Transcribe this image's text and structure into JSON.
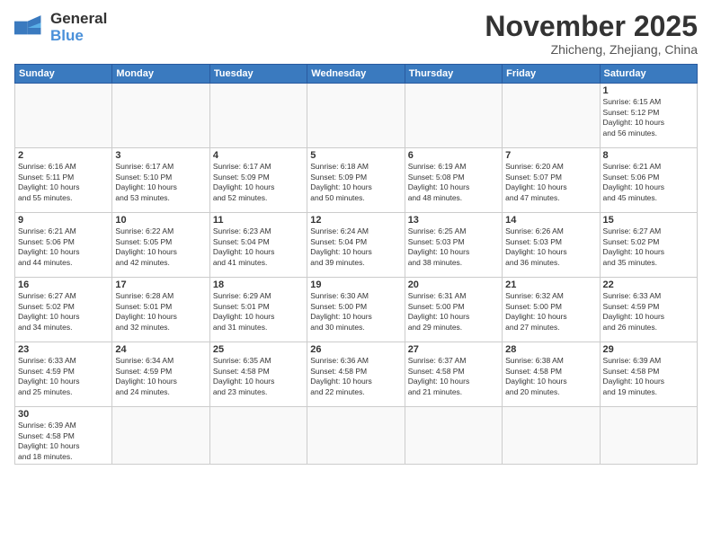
{
  "header": {
    "logo_general": "General",
    "logo_blue": "Blue",
    "month_title": "November 2025",
    "location": "Zhicheng, Zhejiang, China"
  },
  "days_of_week": [
    "Sunday",
    "Monday",
    "Tuesday",
    "Wednesday",
    "Thursday",
    "Friday",
    "Saturday"
  ],
  "weeks": [
    [
      {
        "day": null,
        "info": null
      },
      {
        "day": null,
        "info": null
      },
      {
        "day": null,
        "info": null
      },
      {
        "day": null,
        "info": null
      },
      {
        "day": null,
        "info": null
      },
      {
        "day": null,
        "info": null
      },
      {
        "day": "1",
        "info": "Sunrise: 6:15 AM\nSunset: 5:12 PM\nDaylight: 10 hours\nand 56 minutes."
      }
    ],
    [
      {
        "day": "2",
        "info": "Sunrise: 6:16 AM\nSunset: 5:11 PM\nDaylight: 10 hours\nand 55 minutes."
      },
      {
        "day": "3",
        "info": "Sunrise: 6:17 AM\nSunset: 5:10 PM\nDaylight: 10 hours\nand 53 minutes."
      },
      {
        "day": "4",
        "info": "Sunrise: 6:17 AM\nSunset: 5:09 PM\nDaylight: 10 hours\nand 52 minutes."
      },
      {
        "day": "5",
        "info": "Sunrise: 6:18 AM\nSunset: 5:09 PM\nDaylight: 10 hours\nand 50 minutes."
      },
      {
        "day": "6",
        "info": "Sunrise: 6:19 AM\nSunset: 5:08 PM\nDaylight: 10 hours\nand 48 minutes."
      },
      {
        "day": "7",
        "info": "Sunrise: 6:20 AM\nSunset: 5:07 PM\nDaylight: 10 hours\nand 47 minutes."
      },
      {
        "day": "8",
        "info": "Sunrise: 6:21 AM\nSunset: 5:06 PM\nDaylight: 10 hours\nand 45 minutes."
      }
    ],
    [
      {
        "day": "9",
        "info": "Sunrise: 6:21 AM\nSunset: 5:06 PM\nDaylight: 10 hours\nand 44 minutes."
      },
      {
        "day": "10",
        "info": "Sunrise: 6:22 AM\nSunset: 5:05 PM\nDaylight: 10 hours\nand 42 minutes."
      },
      {
        "day": "11",
        "info": "Sunrise: 6:23 AM\nSunset: 5:04 PM\nDaylight: 10 hours\nand 41 minutes."
      },
      {
        "day": "12",
        "info": "Sunrise: 6:24 AM\nSunset: 5:04 PM\nDaylight: 10 hours\nand 39 minutes."
      },
      {
        "day": "13",
        "info": "Sunrise: 6:25 AM\nSunset: 5:03 PM\nDaylight: 10 hours\nand 38 minutes."
      },
      {
        "day": "14",
        "info": "Sunrise: 6:26 AM\nSunset: 5:03 PM\nDaylight: 10 hours\nand 36 minutes."
      },
      {
        "day": "15",
        "info": "Sunrise: 6:27 AM\nSunset: 5:02 PM\nDaylight: 10 hours\nand 35 minutes."
      }
    ],
    [
      {
        "day": "16",
        "info": "Sunrise: 6:27 AM\nSunset: 5:02 PM\nDaylight: 10 hours\nand 34 minutes."
      },
      {
        "day": "17",
        "info": "Sunrise: 6:28 AM\nSunset: 5:01 PM\nDaylight: 10 hours\nand 32 minutes."
      },
      {
        "day": "18",
        "info": "Sunrise: 6:29 AM\nSunset: 5:01 PM\nDaylight: 10 hours\nand 31 minutes."
      },
      {
        "day": "19",
        "info": "Sunrise: 6:30 AM\nSunset: 5:00 PM\nDaylight: 10 hours\nand 30 minutes."
      },
      {
        "day": "20",
        "info": "Sunrise: 6:31 AM\nSunset: 5:00 PM\nDaylight: 10 hours\nand 29 minutes."
      },
      {
        "day": "21",
        "info": "Sunrise: 6:32 AM\nSunset: 5:00 PM\nDaylight: 10 hours\nand 27 minutes."
      },
      {
        "day": "22",
        "info": "Sunrise: 6:33 AM\nSunset: 4:59 PM\nDaylight: 10 hours\nand 26 minutes."
      }
    ],
    [
      {
        "day": "23",
        "info": "Sunrise: 6:33 AM\nSunset: 4:59 PM\nDaylight: 10 hours\nand 25 minutes."
      },
      {
        "day": "24",
        "info": "Sunrise: 6:34 AM\nSunset: 4:59 PM\nDaylight: 10 hours\nand 24 minutes."
      },
      {
        "day": "25",
        "info": "Sunrise: 6:35 AM\nSunset: 4:58 PM\nDaylight: 10 hours\nand 23 minutes."
      },
      {
        "day": "26",
        "info": "Sunrise: 6:36 AM\nSunset: 4:58 PM\nDaylight: 10 hours\nand 22 minutes."
      },
      {
        "day": "27",
        "info": "Sunrise: 6:37 AM\nSunset: 4:58 PM\nDaylight: 10 hours\nand 21 minutes."
      },
      {
        "day": "28",
        "info": "Sunrise: 6:38 AM\nSunset: 4:58 PM\nDaylight: 10 hours\nand 20 minutes."
      },
      {
        "day": "29",
        "info": "Sunrise: 6:39 AM\nSunset: 4:58 PM\nDaylight: 10 hours\nand 19 minutes."
      }
    ],
    [
      {
        "day": "30",
        "info": "Sunrise: 6:39 AM\nSunset: 4:58 PM\nDaylight: 10 hours\nand 18 minutes."
      },
      {
        "day": null,
        "info": null
      },
      {
        "day": null,
        "info": null
      },
      {
        "day": null,
        "info": null
      },
      {
        "day": null,
        "info": null
      },
      {
        "day": null,
        "info": null
      },
      {
        "day": null,
        "info": null
      }
    ]
  ]
}
